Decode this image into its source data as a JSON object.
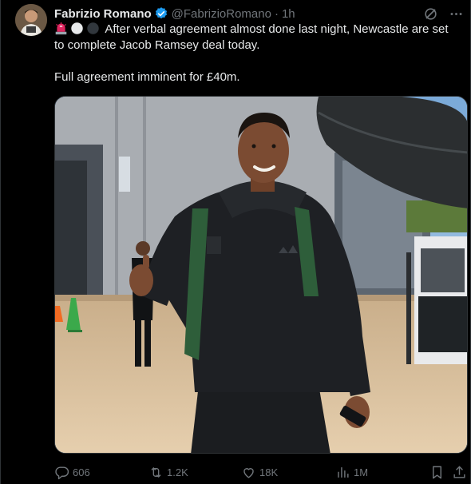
{
  "tweet": {
    "author_name": "Fabrizio Romano",
    "author_handle": "@FabrizioRomano",
    "separator": "·",
    "time": "1h",
    "lines": [
      "After verbal agreement almost done last night, Newcastle are set",
      "to complete Jacob Ramsey deal today."
    ],
    "second_paragraph": "Full agreement imminent for £40m.",
    "emojis": [
      "siren-emoji",
      "white-circle-emoji",
      "black-circle-emoji"
    ]
  },
  "stats": {
    "replies": "606",
    "reposts": "1.2K",
    "likes": "18K",
    "views": "1M"
  },
  "colors": {
    "background": "#000000",
    "text": "#e7e9ea",
    "muted": "#71767b",
    "verified": "#1d9bf0",
    "border": "#2f3336"
  }
}
